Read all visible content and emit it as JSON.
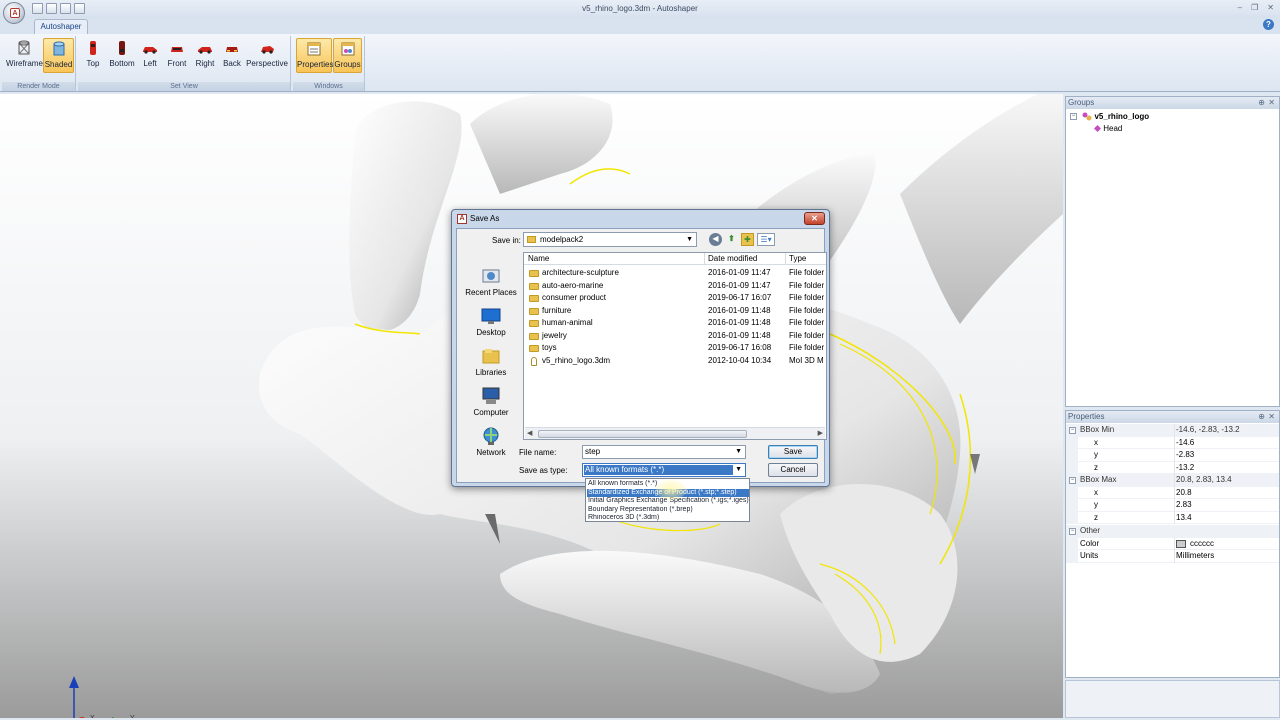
{
  "window": {
    "title": "v5_rhino_logo.3dm - Autoshaper",
    "controls": [
      "–",
      "❐",
      "✕"
    ]
  },
  "app_orb": {
    "glyph": "A"
  },
  "ribbon": {
    "tab": "Autoshaper",
    "help": "?",
    "groups": {
      "render_mode": {
        "label": "Render Mode",
        "buttons": {
          "wireframe": "Wireframe",
          "shaded": "Shaded"
        },
        "active": "shaded"
      },
      "set_view": {
        "label": "Set View",
        "buttons": {
          "top": "Top",
          "bottom": "Bottom",
          "left": "Left",
          "front": "Front",
          "right": "Right",
          "back": "Back",
          "perspective": "Perspective"
        }
      },
      "windows": {
        "label": "Windows",
        "buttons": {
          "properties": "Properties",
          "groups": "Groups"
        },
        "active": [
          "properties",
          "groups"
        ]
      }
    }
  },
  "viewport": {
    "axis": {
      "z": "Z",
      "x": "X",
      "y": "Y"
    },
    "colors": {
      "outline": "#f2e600",
      "surface": "#f5f5f5"
    }
  },
  "groups_pane": {
    "title": "Groups",
    "tree": {
      "root": "v5_rhino_logo",
      "child": "Head"
    }
  },
  "properties_pane": {
    "title": "Properties",
    "rows": {
      "bbox_min": {
        "label": "BBox Min",
        "value": "-14.6, -2.83, -13.2"
      },
      "bbox_min_x": {
        "label": "x",
        "value": "-14.6"
      },
      "bbox_min_y": {
        "label": "y",
        "value": "-2.83"
      },
      "bbox_min_z": {
        "label": "z",
        "value": "-13.2"
      },
      "bbox_max": {
        "label": "BBox Max",
        "value": "20.8, 2.83, 13.4"
      },
      "bbox_max_x": {
        "label": "x",
        "value": "20.8"
      },
      "bbox_max_y": {
        "label": "y",
        "value": "2.83"
      },
      "bbox_max_z": {
        "label": "z",
        "value": "13.4"
      },
      "other": {
        "label": "Other"
      },
      "color": {
        "label": "Color",
        "value": "cccccc",
        "swatch": "#cccccc"
      },
      "units": {
        "label": "Units",
        "value": "Millimeters"
      }
    }
  },
  "dialog": {
    "title": "Save As",
    "save_in_label": "Save in:",
    "save_in_value": "modelpack2",
    "places": {
      "recent": "Recent Places",
      "desktop": "Desktop",
      "libraries": "Libraries",
      "computer": "Computer",
      "network": "Network"
    },
    "columns": {
      "name": "Name",
      "date": "Date modified",
      "type": "Type"
    },
    "files": [
      {
        "name": "architecture-sculpture",
        "date": "2016-01-09 11:47",
        "type": "File folder",
        "kind": "folder"
      },
      {
        "name": "auto-aero-marine",
        "date": "2016-01-09 11:47",
        "type": "File folder",
        "kind": "folder"
      },
      {
        "name": "consumer product",
        "date": "2019-06-17 16:07",
        "type": "File folder",
        "kind": "folder"
      },
      {
        "name": "furniture",
        "date": "2016-01-09 11:48",
        "type": "File folder",
        "kind": "folder"
      },
      {
        "name": "human-animal",
        "date": "2016-01-09 11:48",
        "type": "File folder",
        "kind": "folder"
      },
      {
        "name": "jewelry",
        "date": "2016-01-09 11:48",
        "type": "File folder",
        "kind": "folder"
      },
      {
        "name": "toys",
        "date": "2019-06-17 16:08",
        "type": "File folder",
        "kind": "folder"
      },
      {
        "name": "v5_rhino_logo.3dm",
        "date": "2012-10-04 10:34",
        "type": "MoI 3D M",
        "kind": "file"
      }
    ],
    "file_name_label": "File name:",
    "file_name_value": "step",
    "save_type_label": "Save as type:",
    "save_type_value": "All known formats (*.*)",
    "save_button": "Save",
    "cancel_button": "Cancel",
    "type_options": [
      "All known formats (*.*)",
      "Standardized Exchange of Product (*.stp;*.step)",
      "Initial Graphics Exchange Specification (*.igs;*.iges)",
      "Boundary Representation (*.brep)",
      "Rhinoceros 3D (*.3dm)"
    ],
    "highlighted_option": 1
  }
}
